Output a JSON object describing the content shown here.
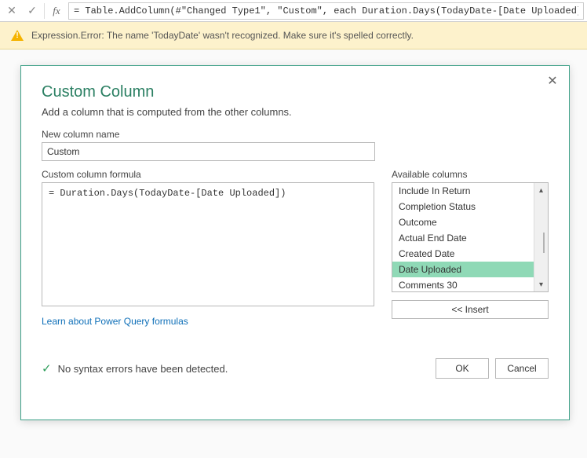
{
  "formula_bar": {
    "formula": "= Table.AddColumn(#\"Changed Type1\", \"Custom\", each Duration.Days(TodayDate-[Date Uploaded]))"
  },
  "error_banner": {
    "text": "Expression.Error: The name 'TodayDate' wasn't recognized.  Make sure it's spelled correctly."
  },
  "dialog": {
    "title": "Custom Column",
    "subtitle": "Add a column that is computed from the other columns.",
    "new_col_label": "New column name",
    "new_col_value": "Custom",
    "formula_label": "Custom column formula",
    "formula_value": "= Duration.Days(TodayDate-[Date Uploaded])",
    "available_label": "Available columns",
    "available_items": [
      "Include In Return",
      "Completion Status",
      "Outcome",
      "Actual End Date",
      "Created Date",
      "Date Uploaded",
      "Comments 30"
    ],
    "selected_index": 5,
    "insert_label": "<< Insert",
    "learn_link": "Learn about Power Query formulas",
    "status_text": "No syntax errors have been detected.",
    "ok_label": "OK",
    "cancel_label": "Cancel"
  }
}
